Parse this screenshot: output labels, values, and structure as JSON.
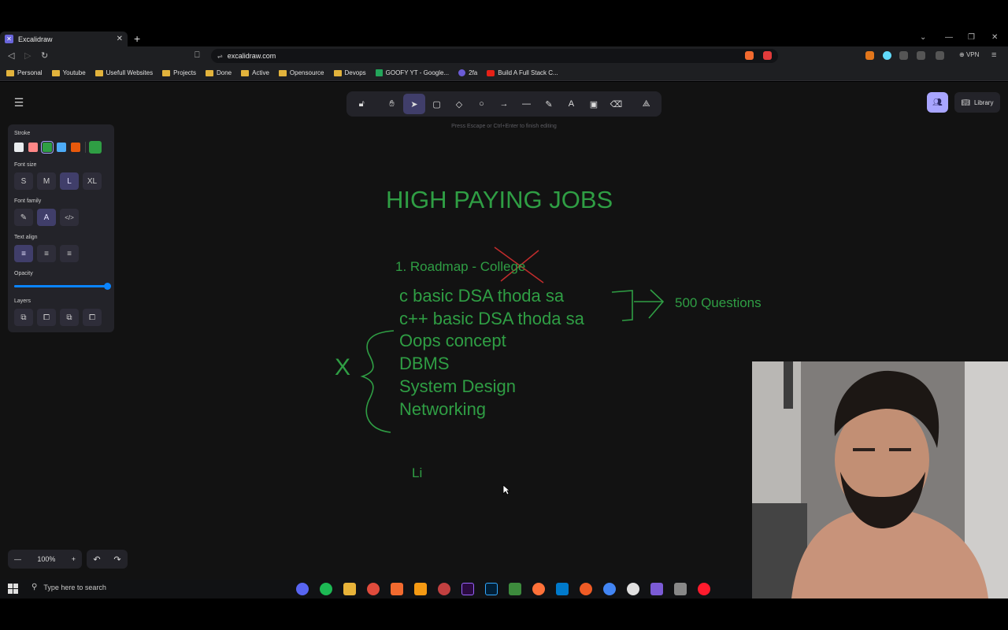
{
  "browser": {
    "tab_title": "Excalidraw",
    "url": "excalidraw.com",
    "vpn_label": "VPN",
    "bookmarks": [
      "Personal",
      "Youtube",
      "Usefull Websites",
      "Projects",
      "Done",
      "Active",
      "Opensource",
      "Devops",
      "GOOFY YT - Google...",
      "2fa",
      "Build A Full Stack C..."
    ]
  },
  "excalidraw": {
    "hint": "Press Escape or Ctrl+Enter to finish editing",
    "library_label": "Library",
    "properties": {
      "stroke_label": "Stroke",
      "stroke_colors": [
        "#e9ecef",
        "#ff8787",
        "#2f9e44",
        "#4dabf7",
        "#e8590c"
      ],
      "stroke_selected": "#2f9e44",
      "font_size_label": "Font size",
      "font_sizes": [
        "S",
        "M",
        "L",
        "XL"
      ],
      "font_size_selected": "L",
      "font_family_label": "Font family",
      "text_align_label": "Text align",
      "opacity_label": "Opacity",
      "opacity_value": 1.0,
      "layers_label": "Layers"
    },
    "zoom": "100%",
    "accent_color": "#a8a5ff"
  },
  "canvas": {
    "title": "HIGH PAYING JOBS",
    "roadmap": "1. Roadmap - College",
    "items": [
      "c basic DSA thoda sa",
      "c++ basic DSA thoda sa",
      "Oops concept",
      "DBMS",
      "System Design",
      "Networking"
    ],
    "questions": "500 Questions",
    "cross_mark": "X",
    "typing": "Li",
    "ink_color": "#2f9e44",
    "strike_color": "#e03131"
  },
  "taskbar": {
    "search_placeholder": "Type here to search"
  }
}
